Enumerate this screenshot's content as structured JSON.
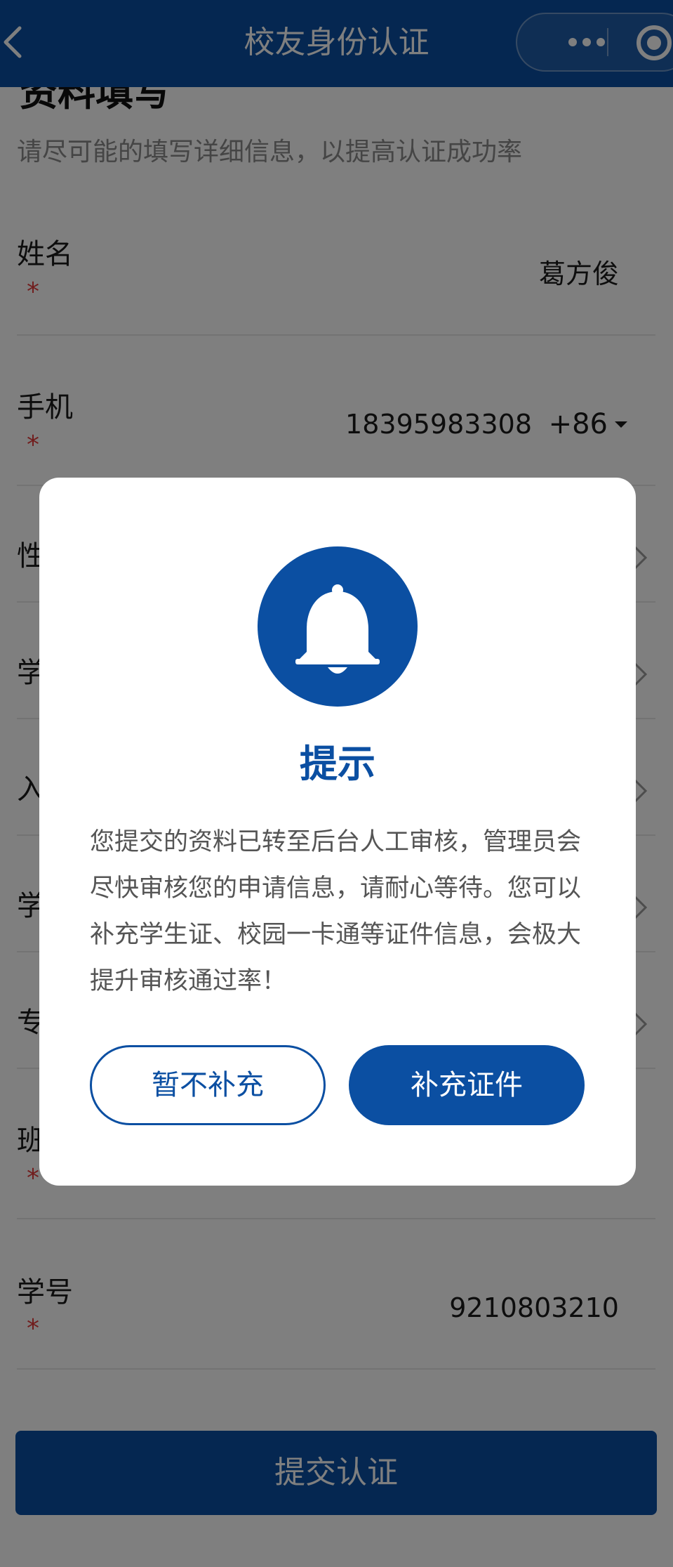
{
  "navbar": {
    "title": "校友身份认证",
    "back_icon": "chevron-left-icon",
    "more_icon": "more-dots-icon",
    "close_icon": "target-circle-icon"
  },
  "form": {
    "section_title": "资料填写",
    "subtitle": "请尽可能的填写详细信息，以提高认证成功率",
    "required_mark": "*",
    "rows": [
      {
        "label": "姓名",
        "value": "葛方俊"
      },
      {
        "label": "手机",
        "value": "18395983308",
        "country_code": "+86"
      },
      {
        "label": "性"
      },
      {
        "label": "学"
      },
      {
        "label": "入"
      },
      {
        "label": "学"
      },
      {
        "label": "专"
      },
      {
        "label": "班"
      },
      {
        "label": "学号",
        "value": "9210803210"
      }
    ],
    "submit_label": "提交认证"
  },
  "dialog": {
    "icon": "bell-icon",
    "title": "提示",
    "message": "您提交的资料已转至后台人工审核，管理员会尽快审核您的申请信息，请耐心等待。您可以补充学生证、校园一卡通等证件信息，会极大提升审核通过率！",
    "skip_label": "暂不补充",
    "supplement_label": "补充证件"
  },
  "colors": {
    "brand": "#0b4fa2",
    "required": "#e23b3b",
    "overlay": "rgba(0,0,0,0.5)"
  }
}
